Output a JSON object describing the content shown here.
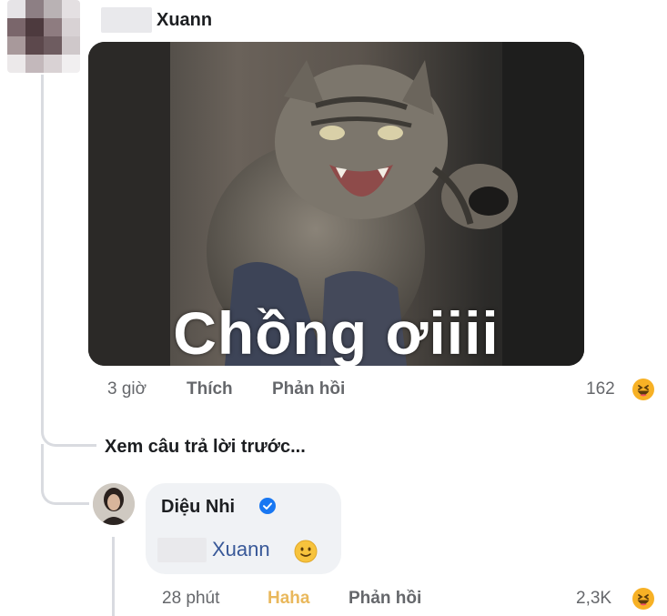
{
  "comment": {
    "author_name": "Xuann",
    "meme_caption": "Chồng ơiiii",
    "time": "3 giờ",
    "like_label": "Thích",
    "reply_label": "Phản hồi",
    "reaction_count": "162",
    "reaction_icon": "haha-emoji-icon"
  },
  "thread": {
    "view_previous_label": "Xem câu trả lời trước..."
  },
  "reply": {
    "author_name": "Diệu Nhi",
    "verified_icon": "verified-badge-icon",
    "mention": "Xuann",
    "emoji_icon": "smile-emoji-icon",
    "time": "28 phút",
    "reaction_label": "Haha",
    "reply_label": "Phản hồi",
    "reaction_count": "2,3K",
    "reaction_icon": "haha-emoji-icon"
  },
  "colors": {
    "haha_reaction": "#e9b85c",
    "mention": "#385898",
    "verified": "#1877f2",
    "bubble_bg": "#f0f2f5",
    "meta_text": "#65676b"
  }
}
